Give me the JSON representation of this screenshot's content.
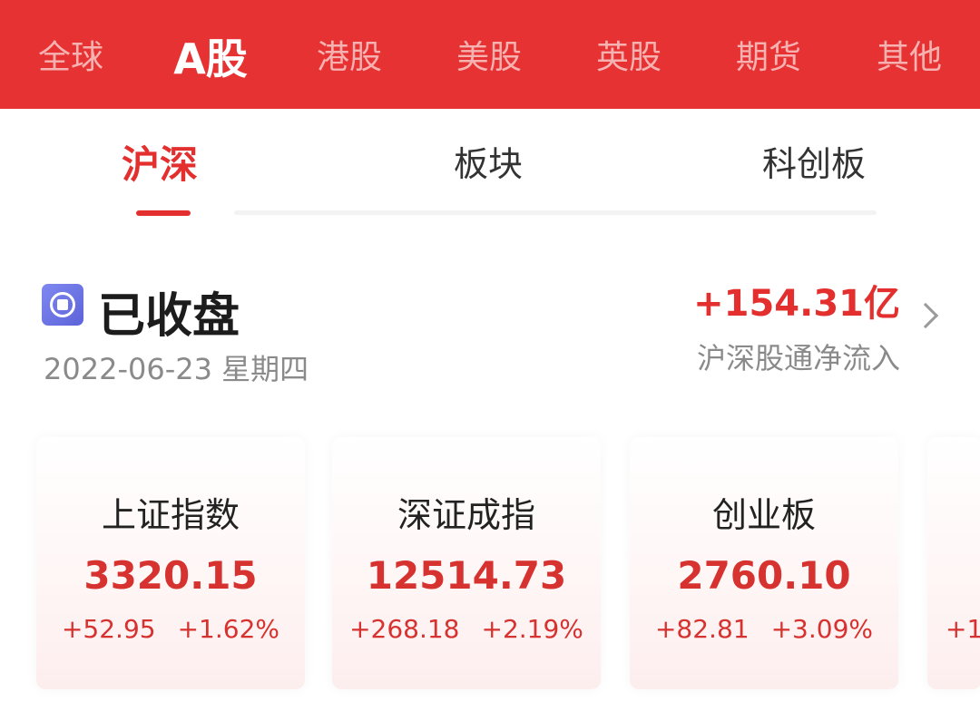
{
  "market_tabs": [
    {
      "label": "全球",
      "active": false
    },
    {
      "label": "A股",
      "active": true
    },
    {
      "label": "港股",
      "active": false
    },
    {
      "label": "美股",
      "active": false
    },
    {
      "label": "英股",
      "active": false
    },
    {
      "label": "期货",
      "active": false
    },
    {
      "label": "其他",
      "active": false
    }
  ],
  "sub_tabs": [
    {
      "label": "沪深",
      "active": true
    },
    {
      "label": "板块",
      "active": false
    },
    {
      "label": "科创板",
      "active": false
    }
  ],
  "status": {
    "label": "已收盘",
    "date": "2022-06-23 星期四",
    "icon": "market-closed-icon"
  },
  "northbound": {
    "value": "+154.31亿",
    "label": "沪深股通净流入"
  },
  "indices": [
    {
      "name": "上证指数",
      "value": "3320.15",
      "change": "+52.95",
      "change_pct": "+1.62%"
    },
    {
      "name": "深证成指",
      "value": "12514.73",
      "change": "+268.18",
      "change_pct": "+2.19%"
    },
    {
      "name": "创业板",
      "value": "2760.10",
      "change": "+82.81",
      "change_pct": "+3.09%"
    },
    {
      "name": "",
      "value": "",
      "change": "+1",
      "change_pct": ""
    }
  ],
  "colors": {
    "brand_red": "#e63232",
    "up_red": "#d6322f",
    "muted_text": "#8a8a8a"
  }
}
